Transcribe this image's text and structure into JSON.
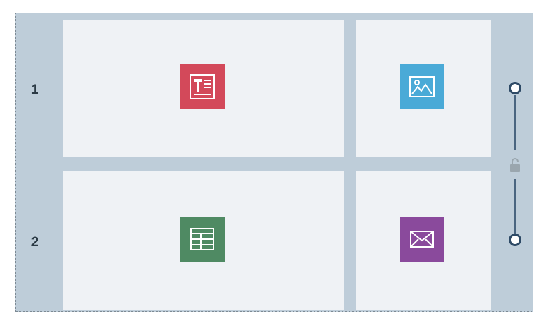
{
  "rows": [
    {
      "label": "1"
    },
    {
      "label": "2"
    }
  ],
  "cells": [
    {
      "name": "text-block",
      "icon": "text-icon",
      "color": "#d3495a"
    },
    {
      "name": "image-block",
      "icon": "image-icon",
      "color": "#4aaad7"
    },
    {
      "name": "table-block",
      "icon": "table-icon",
      "color": "#4f8a63"
    },
    {
      "name": "email-block",
      "icon": "email-icon",
      "color": "#8a4a9c"
    }
  ],
  "divider": {
    "lock_icon": "unlock-icon",
    "handle_color": "#2e4a66"
  }
}
